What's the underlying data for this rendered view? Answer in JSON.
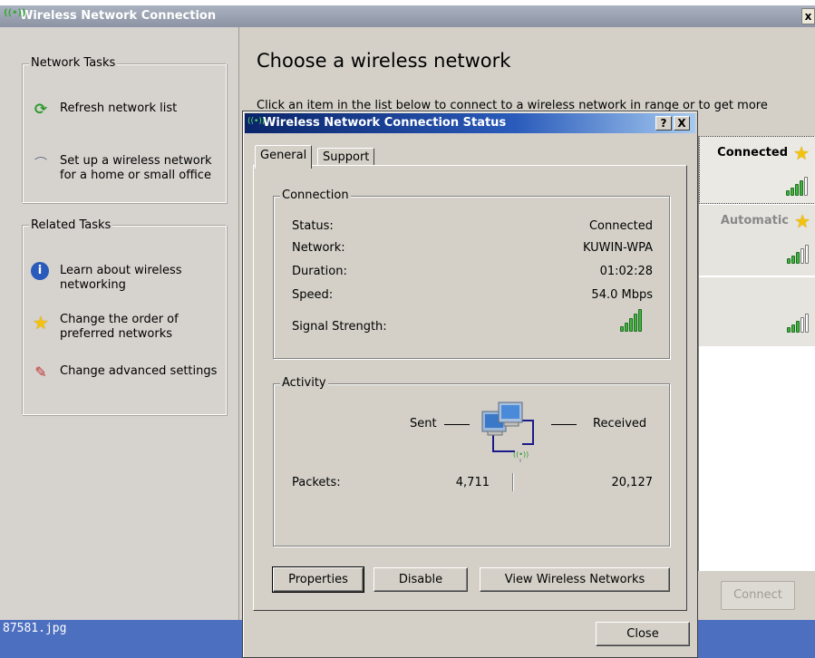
{
  "main_window": {
    "title": "Wireless Network Connection",
    "close_label": "x"
  },
  "network_tasks": {
    "heading": "Network Tasks",
    "items": [
      {
        "label": "Refresh network list",
        "icon": "refresh-icon"
      },
      {
        "label": "Set up a wireless network for a home or small office",
        "icon": "wireless-setup-icon"
      }
    ]
  },
  "related_tasks": {
    "heading": "Related Tasks",
    "items": [
      {
        "label": "Learn about wireless networking",
        "icon": "info-icon"
      },
      {
        "label": "Change the order of preferred networks",
        "icon": "star-icon"
      },
      {
        "label": "Change advanced settings",
        "icon": "tools-icon"
      }
    ]
  },
  "main_content": {
    "title": "Choose a wireless network",
    "description": "Click an item in the list below to connect to a wireless network in range or to get more",
    "connect_button": "Connect"
  },
  "network_list": [
    {
      "status": "Connected",
      "signal_bars": 4
    },
    {
      "status": "Automatic",
      "signal_bars": 3
    },
    {
      "status": "",
      "signal_bars": 3
    }
  ],
  "taskbar": {
    "filename": "87581.jpg"
  },
  "dialog": {
    "title": "Wireless Network Connection Status",
    "help_label": "?",
    "close_label": "X",
    "tabs": [
      "General",
      "Support"
    ],
    "active_tab": "General",
    "connection": {
      "heading": "Connection",
      "rows": [
        {
          "label": "Status:",
          "value": "Connected"
        },
        {
          "label": "Network:",
          "value": "KUWIN-WPA"
        },
        {
          "label": "Duration:",
          "value": "01:02:28"
        },
        {
          "label": "Speed:",
          "value": "54.0 Mbps"
        }
      ],
      "signal_label": "Signal Strength:",
      "signal_bars": 5
    },
    "activity": {
      "heading": "Activity",
      "sent_label": "Sent",
      "received_label": "Received",
      "packets_label": "Packets:",
      "sent_packets": "4,711",
      "received_packets": "20,127"
    },
    "buttons": {
      "properties": "Properties",
      "disable": "Disable",
      "view_networks": "View Wireless Networks",
      "close": "Close"
    }
  },
  "colors": {
    "dialog_title_start": "#0a246a",
    "dialog_title_end": "#a6caf0",
    "signal_green": "#41b441",
    "taskbar_blue": "#4d6fbf",
    "star_yellow": "#f4c20d"
  }
}
